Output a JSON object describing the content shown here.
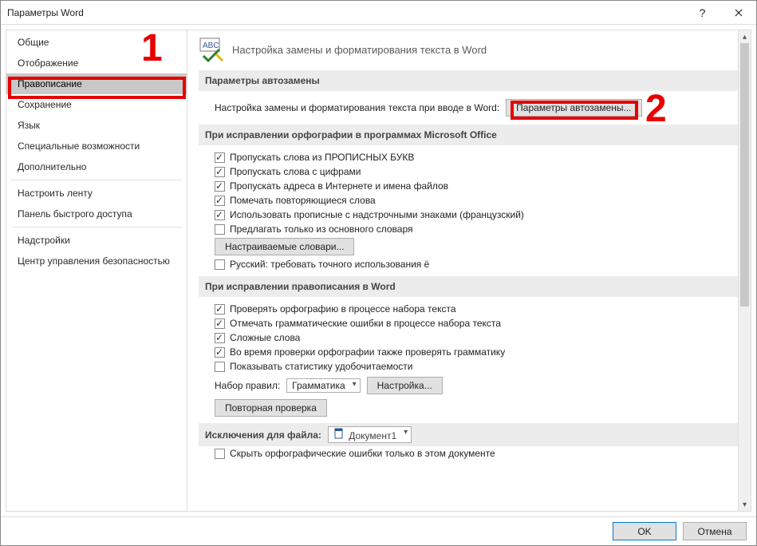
{
  "window": {
    "title": "Параметры Word"
  },
  "sidebar": {
    "groups": [
      [
        "Общие",
        "Отображение",
        "Правописание",
        "Сохранение",
        "Язык",
        "Специальные возможности",
        "Дополнительно"
      ],
      [
        "Настроить ленту",
        "Панель быстрого доступа"
      ],
      [
        "Надстройки",
        "Центр управления безопасностью"
      ]
    ],
    "selected": "Правописание"
  },
  "header": {
    "text": "Настройка замены и форматирования текста в Word"
  },
  "section_autocorrect": {
    "title": "Параметры автозамены",
    "desc": "Настройка замены и форматирования текста при вводе в Word:",
    "button": "Параметры автозамены..."
  },
  "section_spell_office": {
    "title": "При исправлении орфографии в программах Microsoft Office",
    "items": [
      {
        "label": "Пропускать слова из ПРОПИСНЫХ БУКВ",
        "checked": true
      },
      {
        "label": "Пропускать слова с цифрами",
        "checked": true
      },
      {
        "label": "Пропускать адреса в Интернете и имена файлов",
        "checked": true
      },
      {
        "label": "Помечать повторяющиеся слова",
        "checked": true
      },
      {
        "label": "Использовать прописные с надстрочными знаками (французский)",
        "checked": true
      },
      {
        "label": "Предлагать только из основного словаря",
        "checked": false
      }
    ],
    "dict_button": "Настраиваемые словари...",
    "extra": {
      "label": "Русский: требовать точного использования ё",
      "checked": false
    }
  },
  "section_spell_word": {
    "title": "При исправлении правописания в Word",
    "items": [
      {
        "label": "Проверять орфографию в процессе набора текста",
        "checked": true
      },
      {
        "label": "Отмечать грамматические ошибки в процессе набора текста",
        "checked": true
      },
      {
        "label": "Сложные слова",
        "checked": true
      },
      {
        "label": "Во время проверки орфографии также проверять грамматику",
        "checked": true
      },
      {
        "label": "Показывать статистику удобочитаемости",
        "checked": false
      }
    ],
    "ruleset_label": "Набор правил:",
    "ruleset_value": "Грамматика",
    "settings_button": "Настройка...",
    "recheck_button": "Повторная проверка"
  },
  "section_exceptions": {
    "title": "Исключения для файла:",
    "doc": "Документ1",
    "hide_spelling": {
      "label": "Скрыть орфографические ошибки только в этом документе",
      "checked": false
    }
  },
  "footer": {
    "ok": "OK",
    "cancel": "Отмена"
  },
  "annotations": {
    "n1": "1",
    "n2": "2"
  }
}
